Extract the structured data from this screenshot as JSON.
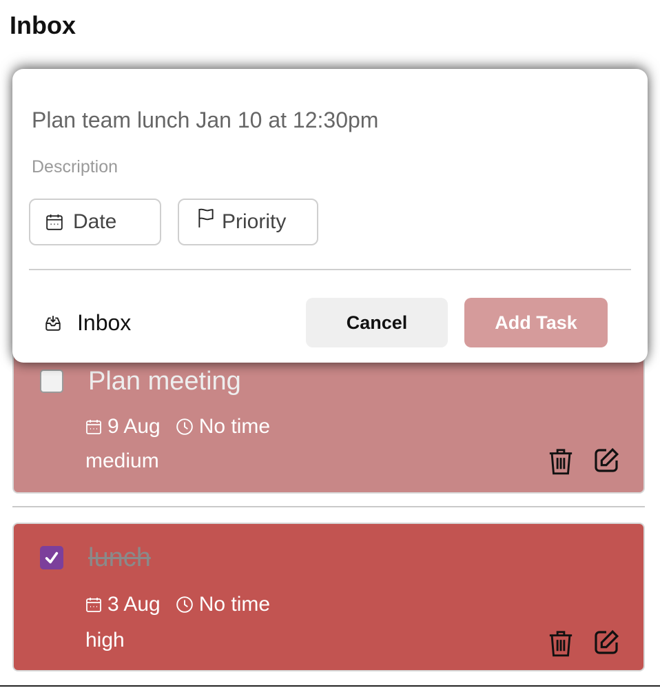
{
  "header": {
    "title": "Inbox"
  },
  "add_task_form": {
    "task_name_value": "Plan team lunch Jan 10 at 12:30pm",
    "description_placeholder": "Description",
    "date_chip_label": "Date",
    "priority_chip_label": "Priority",
    "project_label": "Inbox",
    "cancel_label": "Cancel",
    "add_label": "Add Task",
    "add_button_color": "#d59b9b"
  },
  "tasks": [
    {
      "title": "Plan meeting",
      "date": "9 Aug",
      "time": "No time",
      "priority": "medium",
      "completed": false,
      "card_color": "#c88787"
    },
    {
      "title": "lunch",
      "date": "3 Aug",
      "time": "No time",
      "priority": "high",
      "completed": true,
      "card_color": "#c25451",
      "check_color": "#7c3f9b"
    }
  ],
  "icons": {
    "calendar": "calendar-icon",
    "clock": "clock-icon",
    "flag": "flag-icon",
    "inbox": "inbox-icon",
    "trash": "trash-icon",
    "edit": "edit-icon"
  }
}
